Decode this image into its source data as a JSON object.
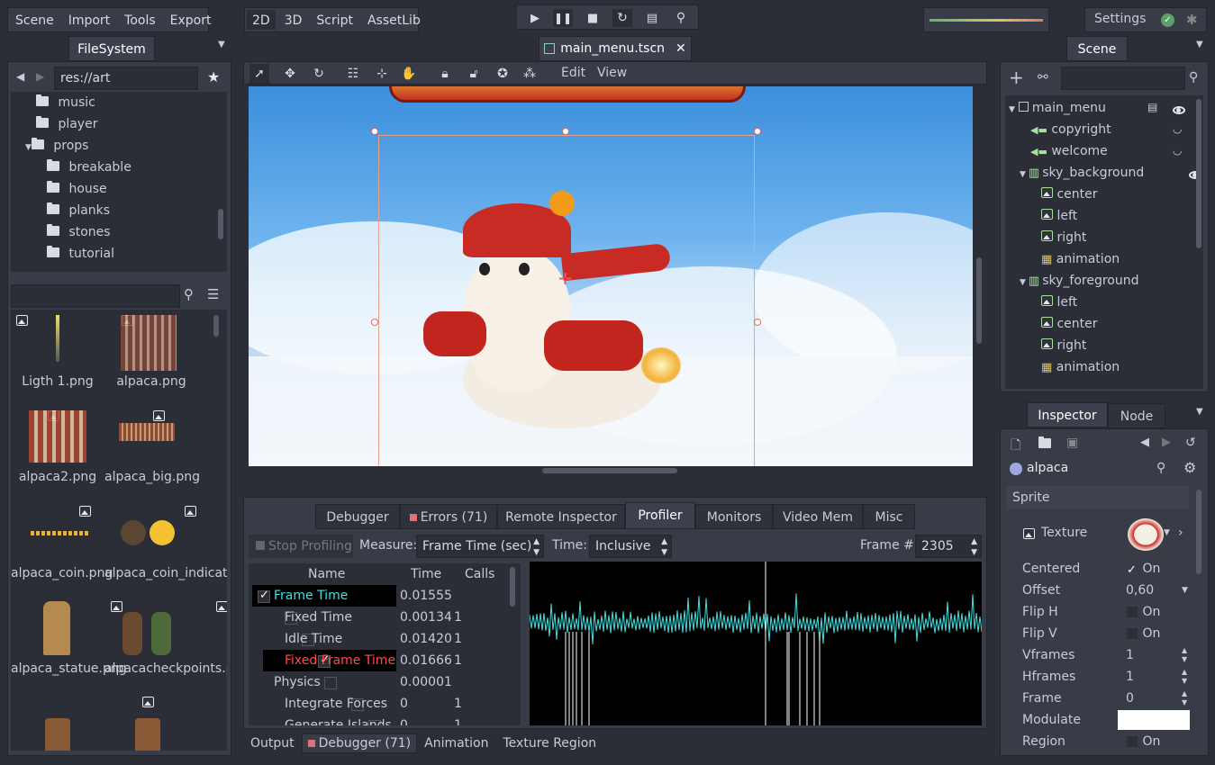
{
  "menu": {
    "scene": "Scene",
    "import": "Import",
    "tools": "Tools",
    "export": "Export"
  },
  "modes": {
    "m2d": "2D",
    "m3d": "3D",
    "script": "Script",
    "assetlib": "AssetLib"
  },
  "settings": {
    "label": "Settings"
  },
  "filesystem": {
    "tab": "FileSystem",
    "path": "res://art",
    "folders": [
      {
        "label": "music"
      },
      {
        "label": "player"
      },
      {
        "label": "props"
      },
      {
        "label": "breakable"
      },
      {
        "label": "house"
      },
      {
        "label": "planks"
      },
      {
        "label": "stones"
      },
      {
        "label": "tutorial"
      }
    ],
    "files": [
      {
        "label": "Ligth 1.png"
      },
      {
        "label": "alpaca.png"
      },
      {
        "label": "alpaca2.png"
      },
      {
        "label": "alpaca_big.png"
      },
      {
        "label": "alpaca_coin.png"
      },
      {
        "label": "alpaca_coin_indicator.png"
      },
      {
        "label": "alpaca_statue.png"
      },
      {
        "label": "alpacacheckpoints.png"
      }
    ]
  },
  "editor": {
    "scene_tab": "main_menu.tscn",
    "edit": "Edit",
    "view": "View"
  },
  "scene_panel": {
    "tab": "Scene",
    "nodes": [
      {
        "label": "main_menu"
      },
      {
        "label": "copyright"
      },
      {
        "label": "welcome"
      },
      {
        "label": "sky_background"
      },
      {
        "label": "center"
      },
      {
        "label": "left"
      },
      {
        "label": "right"
      },
      {
        "label": "animation"
      },
      {
        "label": "sky_foreground"
      },
      {
        "label": "left"
      },
      {
        "label": "center"
      },
      {
        "label": "right"
      },
      {
        "label": "animation"
      }
    ]
  },
  "inspector": {
    "tab": "Inspector",
    "node_tab": "Node",
    "object": "alpaca",
    "section": "Sprite",
    "texture": "Texture",
    "props": [
      {
        "label": "Centered",
        "value": "On"
      },
      {
        "label": "Offset",
        "value": "0,60"
      },
      {
        "label": "Flip H",
        "value": "On"
      },
      {
        "label": "Flip V",
        "value": "On"
      },
      {
        "label": "Vframes",
        "value": "1"
      },
      {
        "label": "Hframes",
        "value": "1"
      },
      {
        "label": "Frame",
        "value": "0"
      },
      {
        "label": "Modulate",
        "value": ""
      },
      {
        "label": "Region",
        "value": "On"
      }
    ]
  },
  "debugger": {
    "tabs": [
      {
        "label": "Debugger"
      },
      {
        "label": "Errors (71)"
      },
      {
        "label": "Remote Inspector"
      },
      {
        "label": "Profiler"
      },
      {
        "label": "Monitors"
      },
      {
        "label": "Video Mem"
      },
      {
        "label": "Misc"
      }
    ],
    "stop": "Stop Profiling",
    "measure_label": "Measure:",
    "measure_value": "Frame Time (sec)",
    "time_label": "Time:",
    "time_value": "Inclusive",
    "frame_label": "Frame #:",
    "frame_value": "2305",
    "headers": {
      "name": "Name",
      "time": "Time",
      "calls": "Calls"
    },
    "rows": [
      {
        "name": "Frame Time",
        "time": "0.01555",
        "calls": ""
      },
      {
        "name": "Fixed Time",
        "time": "0.00134",
        "calls": "1"
      },
      {
        "name": "Idle Time",
        "time": "0.01420",
        "calls": "1"
      },
      {
        "name": "Fixed Frame Time",
        "time": "0.01666",
        "calls": "1"
      },
      {
        "name": "Physics",
        "time": "0.00001",
        "calls": ""
      },
      {
        "name": "Integrate Forces",
        "time": "0",
        "calls": "1"
      },
      {
        "name": "Generate Islands",
        "time": "0",
        "calls": "1"
      }
    ]
  },
  "bottom": {
    "output": "Output",
    "debugger": "Debugger (71)",
    "animation": "Animation",
    "texture_region": "Texture Region"
  },
  "colors": {
    "accent": "#e0e0e0",
    "highlight": "#ff4a4a",
    "profile_line": "#3ee0e0",
    "canvas_sky": "#5aa9ea"
  }
}
